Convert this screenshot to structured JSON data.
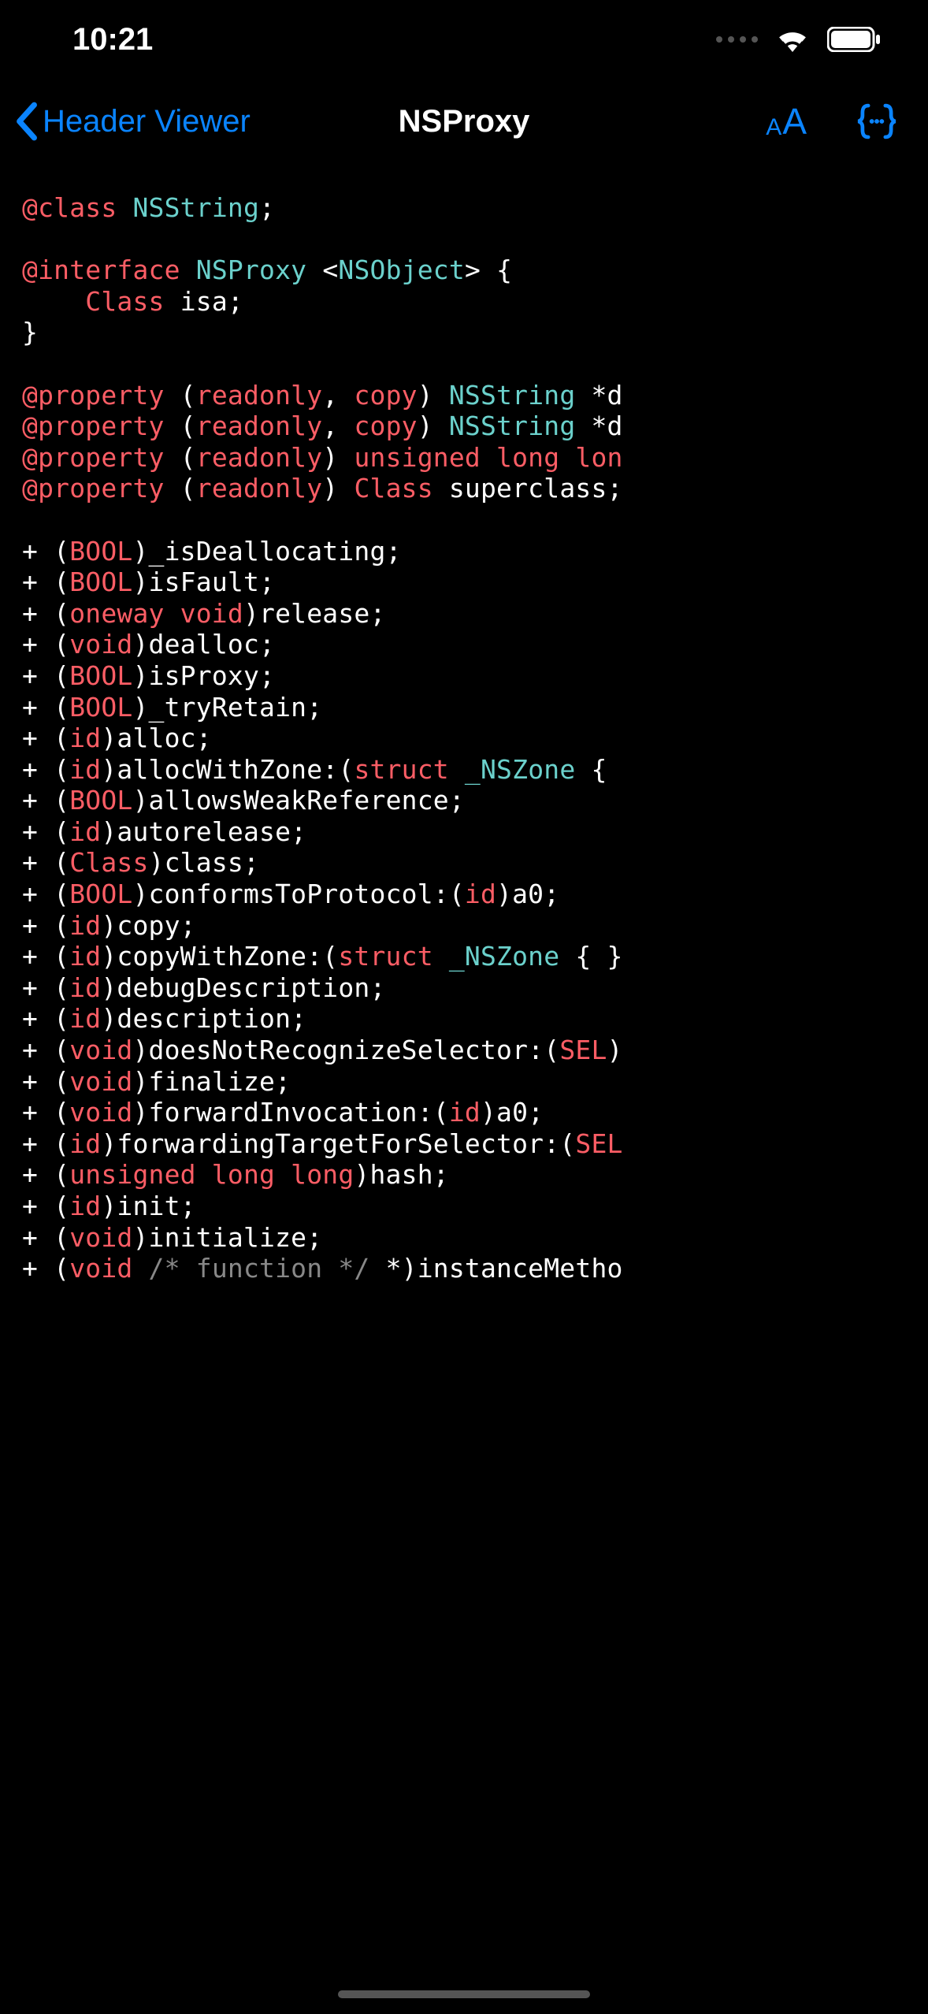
{
  "status": {
    "time": "10:21"
  },
  "nav": {
    "back": "Header Viewer",
    "title": "NSProxy"
  },
  "code": {
    "class_decl": {
      "kw": "@class",
      "type": "NSString",
      "tail": ";"
    },
    "interface": {
      "kw": "@interface",
      "name": "NSProxy",
      "proto": "NSObject",
      "open": "> {"
    },
    "ivar": {
      "kw": "Class",
      "name": " isa;"
    },
    "close_brace": "}",
    "props": [
      {
        "kw": "@property",
        "open": " (",
        "attrs": "readonly",
        "sep": ", ",
        "attrs2": "copy",
        "close": ") ",
        "type": "NSString",
        "tail": " *d"
      },
      {
        "kw": "@property",
        "open": " (",
        "attrs": "readonly",
        "sep": ", ",
        "attrs2": "copy",
        "close": ") ",
        "type": "NSString",
        "tail": " *d"
      },
      {
        "kw": "@property",
        "open": " (",
        "attrs": "readonly",
        "sep": "",
        "attrs2": "",
        "close": ") ",
        "type_kw": "unsigned long lon",
        "tail": ""
      },
      {
        "kw": "@property",
        "open": " (",
        "attrs": "readonly",
        "sep": "",
        "attrs2": "",
        "close": ") ",
        "type_kw": "Class",
        "tail": " superclass;"
      }
    ],
    "methods": [
      {
        "pre": "+ (",
        "t": "BOOL",
        "post": ")_isDeallocating;"
      },
      {
        "pre": "+ (",
        "t": "BOOL",
        "post": ")isFault;"
      },
      {
        "pre": "+ (",
        "t": "oneway void",
        "post": ")release;"
      },
      {
        "pre": "+ (",
        "t": "void",
        "post": ")dealloc;"
      },
      {
        "pre": "+ (",
        "t": "BOOL",
        "post": ")isProxy;"
      },
      {
        "pre": "+ (",
        "t": "BOOL",
        "post": ")_tryRetain;"
      },
      {
        "pre": "+ (",
        "t": "id",
        "post": ")alloc;"
      },
      {
        "pre": "+ (",
        "t": "id",
        "post": ")allocWithZone:(",
        "t2": "struct",
        "between": " ",
        "type": "_NSZone",
        "tail": " {"
      },
      {
        "pre": "+ (",
        "t": "BOOL",
        "post": ")allowsWeakReference;"
      },
      {
        "pre": "+ (",
        "t": "id",
        "post": ")autorelease;"
      },
      {
        "pre": "+ (",
        "t": "Class",
        "post": ")class;"
      },
      {
        "pre": "+ (",
        "t": "BOOL",
        "post": ")conformsToProtocol:(",
        "t2": "id",
        "tail": ")a0;"
      },
      {
        "pre": "+ (",
        "t": "id",
        "post": ")copy;"
      },
      {
        "pre": "+ (",
        "t": "id",
        "post": ")copyWithZone:(",
        "t2": "struct",
        "between": " ",
        "type": "_NSZone",
        "tail": " { }"
      },
      {
        "pre": "+ (",
        "t": "id",
        "post": ")debugDescription;"
      },
      {
        "pre": "+ (",
        "t": "id",
        "post": ")description;"
      },
      {
        "pre": "+ (",
        "t": "void",
        "post": ")doesNotRecognizeSelector:(",
        "t2": "SEL",
        "tail": ")"
      },
      {
        "pre": "+ (",
        "t": "void",
        "post": ")finalize;"
      },
      {
        "pre": "+ (",
        "t": "void",
        "post": ")forwardInvocation:(",
        "t2": "id",
        "tail": ")a0;"
      },
      {
        "pre": "+ (",
        "t": "id",
        "post": ")forwardingTargetForSelector:(",
        "t2": "SEL",
        "tail": ""
      },
      {
        "pre": "+ (",
        "t": "unsigned long long",
        "post": ")hash;"
      },
      {
        "pre": "+ (",
        "t": "id",
        "post": ")init;"
      },
      {
        "pre": "+ (",
        "t": "void",
        "post": ")initialize;"
      },
      {
        "pre": "+ (",
        "t": "void",
        "comment": " /* function */",
        "post": " *)instanceMetho"
      }
    ]
  }
}
